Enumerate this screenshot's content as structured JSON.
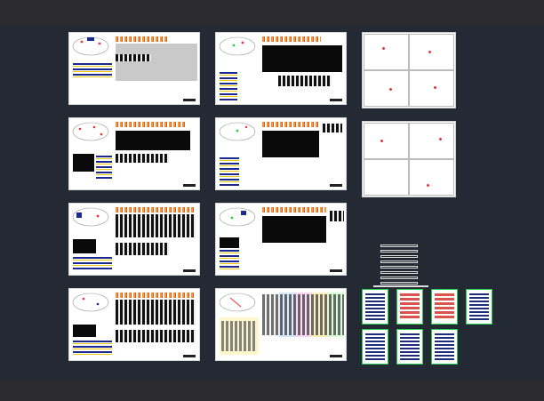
{
  "viewport": {
    "background": "#2b2b30",
    "model_space": "#242a33"
  },
  "sheets": [
    {
      "id": "s1",
      "caption": ""
    },
    {
      "id": "s2",
      "caption": ""
    },
    {
      "id": "s3",
      "caption": ""
    },
    {
      "id": "s4",
      "caption": ""
    },
    {
      "id": "s5",
      "caption": ""
    },
    {
      "id": "s6",
      "caption": ""
    },
    {
      "id": "s7",
      "caption": ""
    },
    {
      "id": "s8",
      "caption": ""
    }
  ],
  "details": {
    "grid_a": {
      "label": ""
    },
    "grid_b": {
      "label": ""
    },
    "tower": {
      "label": ""
    },
    "mini_sheets": [
      "",
      "",
      "",
      "",
      "",
      "",
      ""
    ]
  },
  "colors": {
    "sheet": "#ffffff",
    "accent_orange": "#f39a2a",
    "accent_green": "#21d04a",
    "accent_blue": "#1b2a8f"
  }
}
